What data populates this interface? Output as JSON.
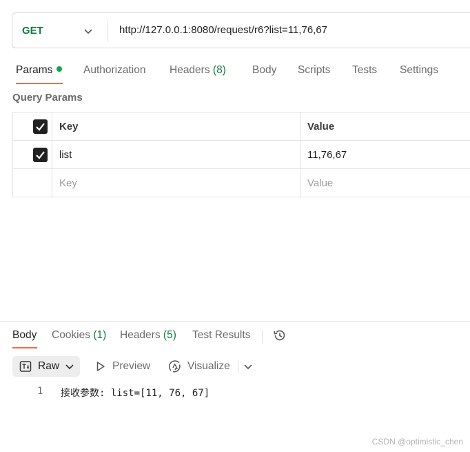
{
  "request": {
    "method": "GET",
    "url": "http://127.0.0.1:8080/request/r6?list=11,76,67"
  },
  "request_tabs": [
    {
      "label": "Params",
      "active": true,
      "has_dot": true
    },
    {
      "label": "Authorization"
    },
    {
      "label": "Headers",
      "count": "(8)"
    },
    {
      "label": "Body"
    },
    {
      "label": "Scripts"
    },
    {
      "label": "Tests"
    },
    {
      "label": "Settings"
    }
  ],
  "query_params": {
    "title": "Query Params",
    "headers": {
      "key": "Key",
      "value": "Value"
    },
    "rows": [
      {
        "key": "list",
        "value": "11,76,67",
        "checked": true
      }
    ],
    "placeholder": {
      "key": "Key",
      "value": "Value"
    }
  },
  "response_tabs": [
    {
      "label": "Body",
      "active": true
    },
    {
      "label": "Cookies",
      "count": "(1)"
    },
    {
      "label": "Headers",
      "count": "(5)"
    },
    {
      "label": "Test Results"
    }
  ],
  "response_toolbar": {
    "raw_label": "Raw",
    "preview_label": "Preview",
    "visualize_label": "Visualize"
  },
  "response_body": {
    "line_number": "1",
    "line": "接收参数: list=[11, 76, 67]"
  },
  "watermark": "CSDN @optimistic_chen",
  "colors": {
    "method_green": "#107e3e",
    "active_underline": "#f26b3a",
    "status_dot": "#10a54a"
  }
}
